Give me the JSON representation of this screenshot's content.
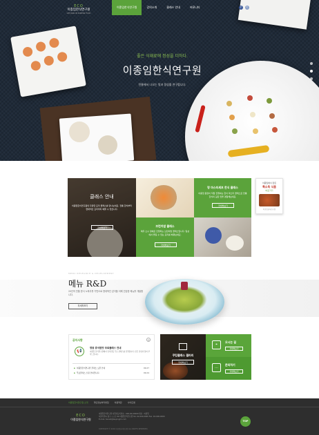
{
  "brand": {
    "mark": "ECO",
    "name": "이종임한식연구원",
    "sub": "LEE JONG IM KOREAN FOOD"
  },
  "nav": {
    "items": [
      {
        "label": "이종임한식연구원",
        "active": true
      },
      {
        "label": "강의소개",
        "active": false
      },
      {
        "label": "클래스 안내",
        "active": false
      },
      {
        "label": "커뮤니티",
        "active": false
      }
    ],
    "social": [
      "f",
      "t"
    ]
  },
  "hero": {
    "tagline": "좋은 식재료에 정성을 더하다.",
    "title": "이종임한식연구원",
    "desc": "전통에서 나오는 맛과 정성을 연구합니다."
  },
  "classes": {
    "main": {
      "title": "클래스 안내",
      "desc": "이종임한식연구원의 다양한 요리 클래스를 만나보세요. 전통 한식부터 현대적인 요리까지 배울 수 있습니다.",
      "button": "자세히보기"
    },
    "master": {
      "title": "명 마스터셰프 한식 클래스",
      "desc": "이종임 원장이 직접 진행하는 한식 마스터 클래스로 전통 한식의 깊은 맛을 경험해보세요.",
      "button": "자세히보기"
    },
    "brunch": {
      "title": "브런치밥 클래스",
      "desc": "매주 소수 정예로 진행되는 브런치밥 클래스입니다. 일상에서 즐길 수 있는 요리를 배워보세요.",
      "button": "자세히보기"
    }
  },
  "promo": {
    "line1": "이종임에서 만든",
    "line2": "특소득 식품",
    "line3": "바로가기",
    "foot": "이종임한식연구원"
  },
  "menu": {
    "eyebrow": "MENU RESEARCH & DEVELOPMENT",
    "title": "메뉴 R&D",
    "desc": "20년의 전통 한식 노하우를 기반으로 현대적인 감각을 더해 건강한 메뉴를 개발합니다.",
    "button": "자세히보기"
  },
  "notice": {
    "heading": "공지사항",
    "plus": "+",
    "icon": "📢",
    "featured_title": "영종 휴식탑맛 무료클래스 안내",
    "featured_body": "이종임 한식연구원에서 휴식탑맛 무료 클래스를 진행합니다. 많은 관심과 참여 부탁드립니다.",
    "rows": [
      {
        "title": "이종임한식연구원 클래스 오픈 안내",
        "date": "09.27"
      },
      {
        "title": "무료클래스 신청 안내입니다.",
        "date": "09.24"
      }
    ]
  },
  "gallery": {
    "title": "쿠킹클래스 갤러리",
    "button": "자세히보기"
  },
  "quick": [
    {
      "icon": "⌖",
      "title": "오시는 길",
      "button": "자세히보기"
    },
    {
      "icon": "…",
      "title": "문의하기",
      "button": "자세히보기"
    }
  ],
  "footer": {
    "links": [
      "이종임한식연구원 소개",
      "개인정보처리방침",
      "이용약관",
      "사이트맵"
    ],
    "info": "이종임한식연구원   사업자등록번호 : 000-00-00000   대표 : 이종임\n서울특별시 중구 ○○로 00 이종임한식연구원   Tel. 02-000-0000   Fax. 02-000-0000\nE-mail. hansik@leejongim.com",
    "copyright": "COPYRIGHT © 2016 이종임한식연구원 ALL RIGHTS RESERVED.",
    "top": "TOP"
  },
  "colors": {
    "accent": "#5ba33b",
    "hero_bg": "#1f2a38",
    "footer_bg": "#2e2e2e"
  }
}
